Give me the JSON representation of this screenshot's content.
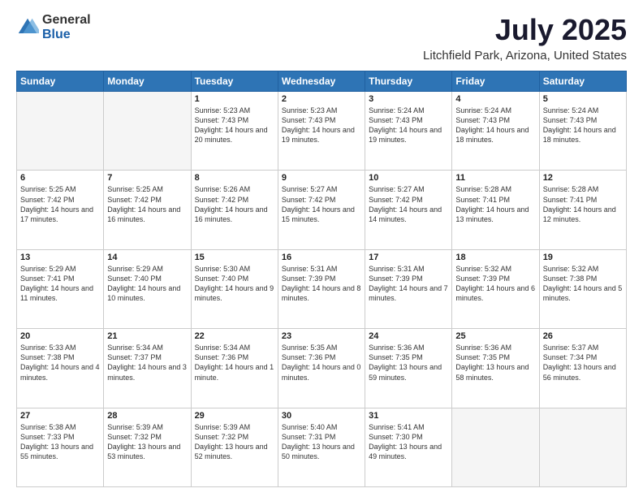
{
  "logo": {
    "general": "General",
    "blue": "Blue"
  },
  "header": {
    "title": "July 2025",
    "subtitle": "Litchfield Park, Arizona, United States"
  },
  "weekdays": [
    "Sunday",
    "Monday",
    "Tuesday",
    "Wednesday",
    "Thursday",
    "Friday",
    "Saturday"
  ],
  "weeks": [
    [
      {
        "day": "",
        "text": ""
      },
      {
        "day": "",
        "text": ""
      },
      {
        "day": "1",
        "text": "Sunrise: 5:23 AM\nSunset: 7:43 PM\nDaylight: 14 hours and 20 minutes."
      },
      {
        "day": "2",
        "text": "Sunrise: 5:23 AM\nSunset: 7:43 PM\nDaylight: 14 hours and 19 minutes."
      },
      {
        "day": "3",
        "text": "Sunrise: 5:24 AM\nSunset: 7:43 PM\nDaylight: 14 hours and 19 minutes."
      },
      {
        "day": "4",
        "text": "Sunrise: 5:24 AM\nSunset: 7:43 PM\nDaylight: 14 hours and 18 minutes."
      },
      {
        "day": "5",
        "text": "Sunrise: 5:24 AM\nSunset: 7:43 PM\nDaylight: 14 hours and 18 minutes."
      }
    ],
    [
      {
        "day": "6",
        "text": "Sunrise: 5:25 AM\nSunset: 7:42 PM\nDaylight: 14 hours and 17 minutes."
      },
      {
        "day": "7",
        "text": "Sunrise: 5:25 AM\nSunset: 7:42 PM\nDaylight: 14 hours and 16 minutes."
      },
      {
        "day": "8",
        "text": "Sunrise: 5:26 AM\nSunset: 7:42 PM\nDaylight: 14 hours and 16 minutes."
      },
      {
        "day": "9",
        "text": "Sunrise: 5:27 AM\nSunset: 7:42 PM\nDaylight: 14 hours and 15 minutes."
      },
      {
        "day": "10",
        "text": "Sunrise: 5:27 AM\nSunset: 7:42 PM\nDaylight: 14 hours and 14 minutes."
      },
      {
        "day": "11",
        "text": "Sunrise: 5:28 AM\nSunset: 7:41 PM\nDaylight: 14 hours and 13 minutes."
      },
      {
        "day": "12",
        "text": "Sunrise: 5:28 AM\nSunset: 7:41 PM\nDaylight: 14 hours and 12 minutes."
      }
    ],
    [
      {
        "day": "13",
        "text": "Sunrise: 5:29 AM\nSunset: 7:41 PM\nDaylight: 14 hours and 11 minutes."
      },
      {
        "day": "14",
        "text": "Sunrise: 5:29 AM\nSunset: 7:40 PM\nDaylight: 14 hours and 10 minutes."
      },
      {
        "day": "15",
        "text": "Sunrise: 5:30 AM\nSunset: 7:40 PM\nDaylight: 14 hours and 9 minutes."
      },
      {
        "day": "16",
        "text": "Sunrise: 5:31 AM\nSunset: 7:39 PM\nDaylight: 14 hours and 8 minutes."
      },
      {
        "day": "17",
        "text": "Sunrise: 5:31 AM\nSunset: 7:39 PM\nDaylight: 14 hours and 7 minutes."
      },
      {
        "day": "18",
        "text": "Sunrise: 5:32 AM\nSunset: 7:39 PM\nDaylight: 14 hours and 6 minutes."
      },
      {
        "day": "19",
        "text": "Sunrise: 5:32 AM\nSunset: 7:38 PM\nDaylight: 14 hours and 5 minutes."
      }
    ],
    [
      {
        "day": "20",
        "text": "Sunrise: 5:33 AM\nSunset: 7:38 PM\nDaylight: 14 hours and 4 minutes."
      },
      {
        "day": "21",
        "text": "Sunrise: 5:34 AM\nSunset: 7:37 PM\nDaylight: 14 hours and 3 minutes."
      },
      {
        "day": "22",
        "text": "Sunrise: 5:34 AM\nSunset: 7:36 PM\nDaylight: 14 hours and 1 minute."
      },
      {
        "day": "23",
        "text": "Sunrise: 5:35 AM\nSunset: 7:36 PM\nDaylight: 14 hours and 0 minutes."
      },
      {
        "day": "24",
        "text": "Sunrise: 5:36 AM\nSunset: 7:35 PM\nDaylight: 13 hours and 59 minutes."
      },
      {
        "day": "25",
        "text": "Sunrise: 5:36 AM\nSunset: 7:35 PM\nDaylight: 13 hours and 58 minutes."
      },
      {
        "day": "26",
        "text": "Sunrise: 5:37 AM\nSunset: 7:34 PM\nDaylight: 13 hours and 56 minutes."
      }
    ],
    [
      {
        "day": "27",
        "text": "Sunrise: 5:38 AM\nSunset: 7:33 PM\nDaylight: 13 hours and 55 minutes."
      },
      {
        "day": "28",
        "text": "Sunrise: 5:39 AM\nSunset: 7:32 PM\nDaylight: 13 hours and 53 minutes."
      },
      {
        "day": "29",
        "text": "Sunrise: 5:39 AM\nSunset: 7:32 PM\nDaylight: 13 hours and 52 minutes."
      },
      {
        "day": "30",
        "text": "Sunrise: 5:40 AM\nSunset: 7:31 PM\nDaylight: 13 hours and 50 minutes."
      },
      {
        "day": "31",
        "text": "Sunrise: 5:41 AM\nSunset: 7:30 PM\nDaylight: 13 hours and 49 minutes."
      },
      {
        "day": "",
        "text": ""
      },
      {
        "day": "",
        "text": ""
      }
    ]
  ]
}
